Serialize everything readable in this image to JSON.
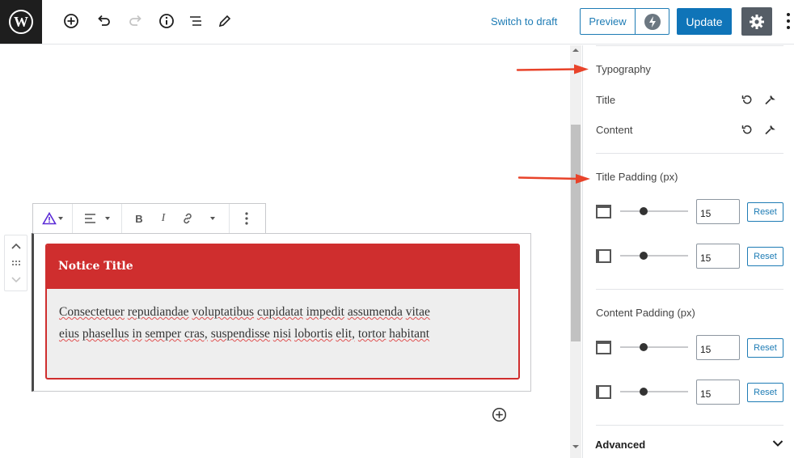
{
  "topbar": {
    "switch_to_draft": "Switch to draft",
    "preview_label": "Preview",
    "update_label": "Update",
    "icons": [
      "wordpress-logo",
      "add-block-icon",
      "undo-icon",
      "redo-icon",
      "info-icon",
      "outline-icon",
      "edit-icon",
      "bolt-icon",
      "settings-icon",
      "more-vertical-icon"
    ]
  },
  "block": {
    "notice_title": "Notice Title",
    "content_line_1": [
      "Consectetuer",
      "repudiandae",
      "voluptatibus",
      "cupidatat",
      "impedit",
      "assumenda",
      "vitae"
    ],
    "content_line_2": [
      "eius",
      "phasellus",
      "in",
      "semper",
      "cras,",
      "suspendisse",
      "nisi",
      "lobortis",
      "elit,",
      "tortor",
      "habitant"
    ]
  },
  "sidebar": {
    "typography_heading": "Typography",
    "title_label": "Title",
    "content_label": "Content",
    "title_padding_heading": "Title Padding (px)",
    "content_padding_heading": "Content Padding (px)",
    "title_padding": [
      {
        "side": "top-bottom",
        "value": "15",
        "reset": "Reset",
        "slider_fraction": 0.35
      },
      {
        "side": "left-right",
        "value": "15",
        "reset": "Reset",
        "slider_fraction": 0.35
      }
    ],
    "content_padding": [
      {
        "side": "top-bottom",
        "value": "15",
        "reset": "Reset",
        "slider_fraction": 0.35
      },
      {
        "side": "left-right",
        "value": "15",
        "reset": "Reset",
        "slider_fraction": 0.35
      }
    ],
    "advanced_label": "Advanced"
  },
  "colors": {
    "accent": "#1e7cb5",
    "update_bg": "#0f74b8",
    "notice_red": "#cf2e2e",
    "annotation_arrow": "#e8432a"
  }
}
